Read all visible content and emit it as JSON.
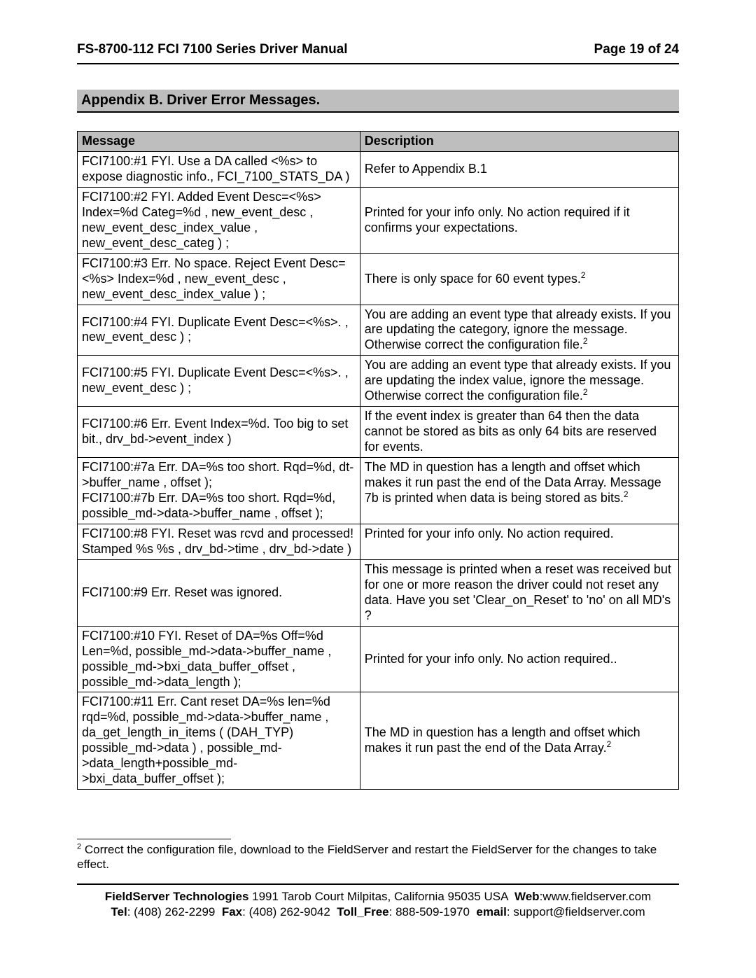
{
  "header": {
    "title": "FS-8700-112 FCI 7100 Series Driver Manual",
    "page": "Page 19 of 24"
  },
  "appendix_title": "Appendix B. Driver Error Messages.",
  "table": {
    "headers": {
      "message": "Message",
      "description": "Description"
    },
    "rows": [
      {
        "msg": "FCI7100:#1 FYI. Use a DA called <%s> to expose diagnostic info., FCI_7100_STATS_DA )",
        "desc": "Refer to Appendix B.1",
        "sup": null,
        "desc_vmid": true
      },
      {
        "msg": "FCI7100:#2 FYI. Added Event Desc=<%s> Index=%d Categ=%d , new_event_desc , new_event_desc_index_value , new_event_desc_categ ) ;",
        "desc": "Printed for your info only. No action required if it confirms your expectations.",
        "sup": null,
        "desc_vmid": true
      },
      {
        "msg": "FCI7100:#3 Err. No space. Reject Event Desc=<%s> Index=%d , new_event_desc , new_event_desc_index_value ) ;",
        "desc": "There is only space for 60 event types.",
        "sup": "2",
        "desc_vmid": true
      },
      {
        "msg": "FCI7100:#4 FYI. Duplicate Event Desc=<%s>. , new_event_desc ) ;",
        "desc": "You are adding an event type that already exists. If you are updating the category, ignore the message. Otherwise correct the configuration file.",
        "sup": "2",
        "msg_vmid": true
      },
      {
        "msg": "FCI7100:#5 FYI. Duplicate Event Desc=<%s>. , new_event_desc ) ;",
        "desc": "You are adding an event type that already exists. If you are updating the index value, ignore the message. Otherwise correct the configuration file.",
        "sup": "2",
        "msg_vmid": true
      },
      {
        "msg": "FCI7100:#6 Err. Event Index=%d. Too big to set bit., drv_bd->event_index )",
        "desc": "If the event index is greater than 64 then the data cannot be stored as bits as only 64 bits are reserved for events.",
        "sup": null,
        "msg_vmid": true
      },
      {
        "msg": "FCI7100:#7a Err. DA=%s too short. Rqd=%d, dt->buffer_name , offset );\nFCI7100:#7b Err. DA=%s too short. Rqd=%d, possible_md->data->buffer_name , offset );",
        "desc": "The MD in question has a length and offset which makes it run past the end of the Data Array. Message 7b is printed when data is being stored as bits.",
        "sup": "2"
      },
      {
        "msg": "FCI7100:#8 FYI. Reset was rcvd and processed! Stamped %s %s , drv_bd->time , drv_bd->date )",
        "desc": "Printed for your info only. No action required.",
        "sup": null
      },
      {
        "msg": "FCI7100:#9 Err. Reset was ignored.",
        "desc": "This message is printed when a reset was received but for one or more reason the driver could not reset any data. Have you set 'Clear_on_Reset' to 'no' on all MD's ?",
        "sup": null,
        "msg_vmid": true
      },
      {
        "msg": "FCI7100:#10 FYI. Reset of DA=%s Off=%d Len=%d, possible_md->data->buffer_name , possible_md->bxi_data_buffer_offset , possible_md->data_length );",
        "desc": "Printed for your info only. No action required..",
        "sup": null,
        "desc_vmid": true
      },
      {
        "msg": "FCI7100:#11 Err. Cant reset DA=%s len=%d rqd=%d, possible_md->data->buffer_name , da_get_length_in_items ( (DAH_TYP) possible_md->data ) , possible_md->data_length+possible_md->bxi_data_buffer_offset );",
        "desc": "The MD in question has a length and offset which makes it run past the end of the Data Array.",
        "sup": "2",
        "desc_vmid": true
      }
    ]
  },
  "footnote": {
    "sup": "2",
    "text": " Correct the configuration file, download to the FieldServer and restart the FieldServer for the changes to take effect."
  },
  "footer": {
    "company": "FieldServer Technologies",
    "addr": " 1991 Tarob Court Milpitas, California 95035 USA ",
    "web_label": "Web",
    "web": ":www.fieldserver.com",
    "tel_label": "Tel",
    "tel": ": (408) 262-2299 ",
    "fax_label": "Fax",
    "fax": ": (408) 262-9042 ",
    "tollfree_label": "Toll_Free",
    "tollfree": ": 888-509-1970 ",
    "email_label": "email",
    "email": ": support@fieldserver.com"
  }
}
